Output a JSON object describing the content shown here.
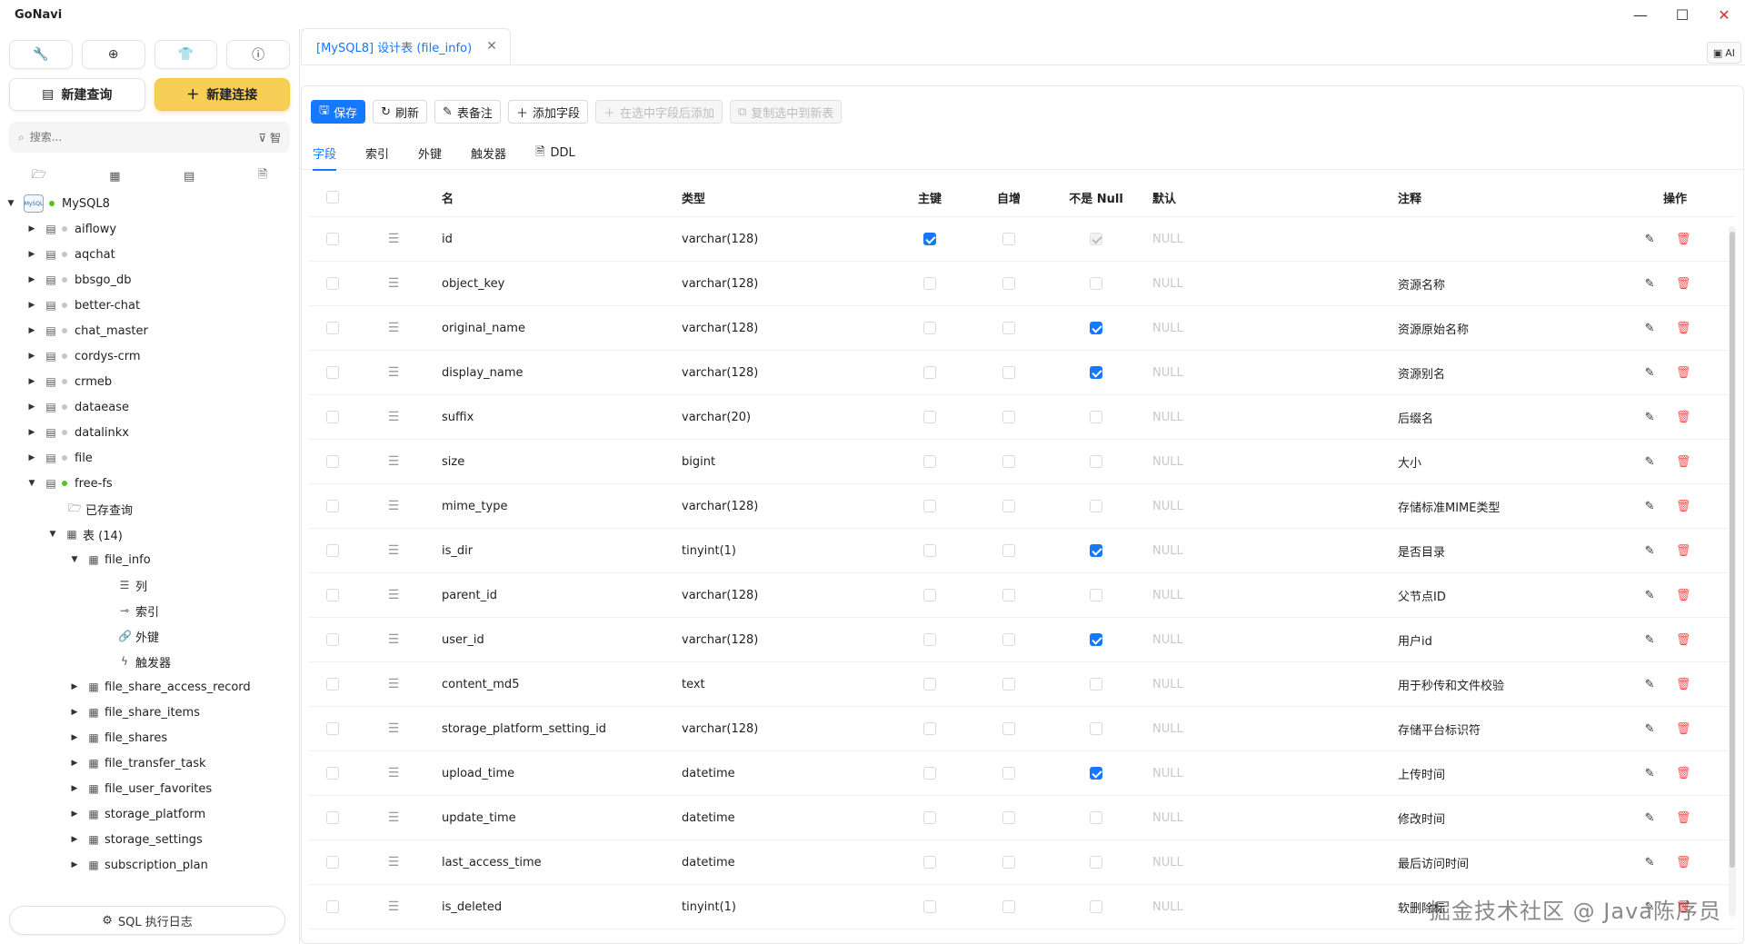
{
  "app": {
    "title": "GoNavi"
  },
  "sidebar": {
    "top_icons": [
      "wrench-icon",
      "globe-icon",
      "shirt-icon",
      "info-icon"
    ],
    "new_query_label": "新建查询",
    "new_connection_label": "新建连接",
    "search_placeholder": "搜索...",
    "filter_label": "智",
    "connection": {
      "name": "MySQL8",
      "icon_text": "MySQL"
    },
    "databases": [
      {
        "name": "aiflowy"
      },
      {
        "name": "aqchat"
      },
      {
        "name": "bbsgo_db"
      },
      {
        "name": "better-chat"
      },
      {
        "name": "chat_master"
      },
      {
        "name": "cordys-crm"
      },
      {
        "name": "crmeb"
      },
      {
        "name": "dataease"
      },
      {
        "name": "datalinkx"
      },
      {
        "name": "file"
      }
    ],
    "open_db": {
      "name": "free-fs",
      "saved_queries_label": "已存查询",
      "tables_label": "表 (14)",
      "open_table": {
        "name": "file_info",
        "children": [
          "列",
          "索引",
          "外键",
          "触发器"
        ]
      },
      "tables": [
        "file_share_access_record",
        "file_share_items",
        "file_shares",
        "file_transfer_task",
        "file_user_favorites",
        "storage_platform",
        "storage_settings",
        "subscription_plan"
      ]
    },
    "sql_log_label": "SQL 执行日志"
  },
  "tab": {
    "title": "[MySQL8] 设计表 (file_info)"
  },
  "ai_label": "AI",
  "toolbar": {
    "save": "保存",
    "refresh": "刷新",
    "table_comment": "表备注",
    "add_field": "添加字段",
    "insert_after": "在选中字段后添加",
    "copy_to_new": "复制选中到新表"
  },
  "subtabs": [
    "字段",
    "索引",
    "外键",
    "触发器",
    "DDL"
  ],
  "columns_header": {
    "name": "名",
    "type": "类型",
    "pk": "主键",
    "ai": "自增",
    "notnull": "不是 Null",
    "default": "默认",
    "comment": "注释",
    "ops": "操作"
  },
  "fields": [
    {
      "name": "id",
      "type": "varchar(128)",
      "pk": true,
      "ai": false,
      "notnull": true,
      "default": "NULL",
      "comment": ""
    },
    {
      "name": "object_key",
      "type": "varchar(128)",
      "pk": false,
      "ai": false,
      "notnull": false,
      "default": "NULL",
      "comment": "资源名称"
    },
    {
      "name": "original_name",
      "type": "varchar(128)",
      "pk": false,
      "ai": false,
      "notnull": true,
      "default": "NULL",
      "comment": "资源原始名称"
    },
    {
      "name": "display_name",
      "type": "varchar(128)",
      "pk": false,
      "ai": false,
      "notnull": true,
      "default": "NULL",
      "comment": "资源别名"
    },
    {
      "name": "suffix",
      "type": "varchar(20)",
      "pk": false,
      "ai": false,
      "notnull": false,
      "default": "NULL",
      "comment": "后缀名"
    },
    {
      "name": "size",
      "type": "bigint",
      "pk": false,
      "ai": false,
      "notnull": false,
      "default": "NULL",
      "comment": "大小"
    },
    {
      "name": "mime_type",
      "type": "varchar(128)",
      "pk": false,
      "ai": false,
      "notnull": false,
      "default": "NULL",
      "comment": "存储标准MIME类型"
    },
    {
      "name": "is_dir",
      "type": "tinyint(1)",
      "pk": false,
      "ai": false,
      "notnull": true,
      "default": "NULL",
      "comment": "是否目录"
    },
    {
      "name": "parent_id",
      "type": "varchar(128)",
      "pk": false,
      "ai": false,
      "notnull": false,
      "default": "NULL",
      "comment": "父节点ID"
    },
    {
      "name": "user_id",
      "type": "varchar(128)",
      "pk": false,
      "ai": false,
      "notnull": true,
      "default": "NULL",
      "comment": "用户id"
    },
    {
      "name": "content_md5",
      "type": "text",
      "pk": false,
      "ai": false,
      "notnull": false,
      "default": "NULL",
      "comment": "用于秒传和文件校验"
    },
    {
      "name": "storage_platform_setting_id",
      "type": "varchar(128)",
      "pk": false,
      "ai": false,
      "notnull": false,
      "default": "NULL",
      "comment": "存储平台标识符"
    },
    {
      "name": "upload_time",
      "type": "datetime",
      "pk": false,
      "ai": false,
      "notnull": true,
      "default": "NULL",
      "comment": "上传时间"
    },
    {
      "name": "update_time",
      "type": "datetime",
      "pk": false,
      "ai": false,
      "notnull": false,
      "default": "NULL",
      "comment": "修改时间"
    },
    {
      "name": "last_access_time",
      "type": "datetime",
      "pk": false,
      "ai": false,
      "notnull": false,
      "default": "NULL",
      "comment": "最后访问时间"
    },
    {
      "name": "is_deleted",
      "type": "tinyint(1)",
      "pk": false,
      "ai": false,
      "notnull": false,
      "default": "NULL",
      "comment": "软删除标"
    }
  ],
  "watermark": "掘金技术社区 @ Java陈序员"
}
